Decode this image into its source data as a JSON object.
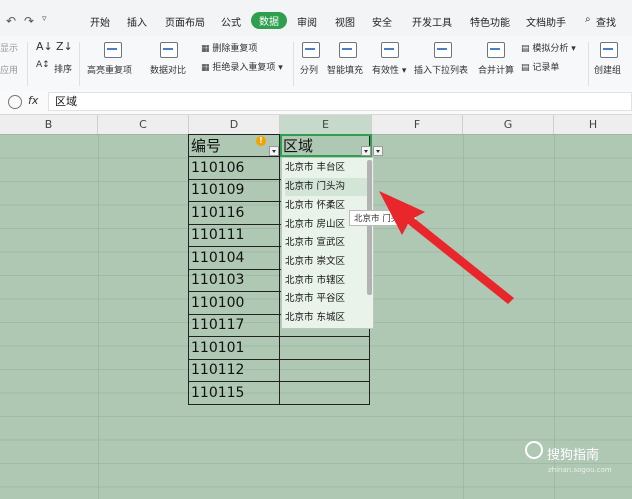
{
  "toolbar_tabs": {
    "t0": "开始",
    "t1": "插入",
    "t2": "页面布局",
    "t3": "公式",
    "t4": "数据",
    "t5": "审阅",
    "t6": "视图",
    "t7": "安全",
    "t8": "开发工具",
    "t9": "特色功能",
    "t10": "文档助手",
    "t11": "查找"
  },
  "ribbon": {
    "show_left": "显示",
    "apply_left": "应用",
    "sort_label": "排序",
    "highlight_dup": "高亮重复项",
    "data_compare": "数据对比",
    "delete_dup": "删除重复项",
    "reject_dup": "拒绝录入重复项",
    "split": "分列",
    "smart_fill": "智能填充",
    "validity": "有效性",
    "insert_dropdown": "插入下拉列表",
    "merge_calc": "合并计算",
    "simulate": "模拟分析",
    "record": "记录单",
    "create_group": "创建组"
  },
  "formula_bar": {
    "fx": "fx",
    "value": "区域"
  },
  "columns": {
    "B": "B",
    "C": "C",
    "D": "D",
    "E": "E",
    "F": "F",
    "G": "G",
    "H": "H"
  },
  "table": {
    "header_d": "编号",
    "header_e": "区域",
    "ids": [
      "110106",
      "110109",
      "110116",
      "110111",
      "110104",
      "110103",
      "110100",
      "110117",
      "110101",
      "110112",
      "110115"
    ]
  },
  "dropdown_items": [
    "北京市  丰台区",
    "北京市  门头沟",
    "北京市  怀柔区",
    "北京市  房山区",
    "北京市  宣武区",
    "北京市  崇文区",
    "北京市  市辖区",
    "北京市  平谷区",
    "北京市  东城区"
  ],
  "tooltip": "北京市  门头沟",
  "watermark": {
    "text": "搜狗指南",
    "url": "zhinan.sogou.com"
  },
  "colors": {
    "accent": "#2e9e4f",
    "sheet_bg": "#cfe6d3",
    "arrow": "#e8262b"
  }
}
